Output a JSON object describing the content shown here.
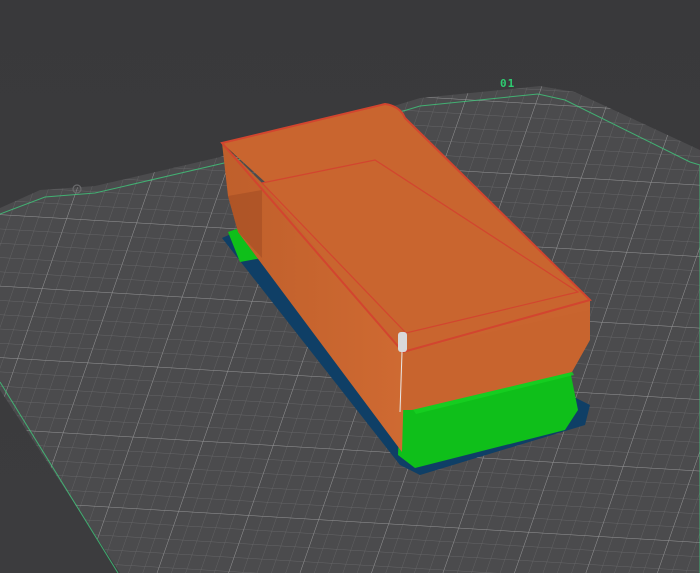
{
  "plate": {
    "label": "01",
    "label_color": "#2ecc71",
    "surface_color": "#4b4b4d",
    "grid_color": "#8a8a8c",
    "edge_color": "#3fd07f"
  },
  "model": {
    "wall_color": "#c8642e",
    "top_edge_color": "#d2452f",
    "inner_wall_color": "#a85226",
    "support_color": "#0fbf1a",
    "brim_color": "#0f3f66",
    "seam_marker_color": "#d9d9d9"
  }
}
